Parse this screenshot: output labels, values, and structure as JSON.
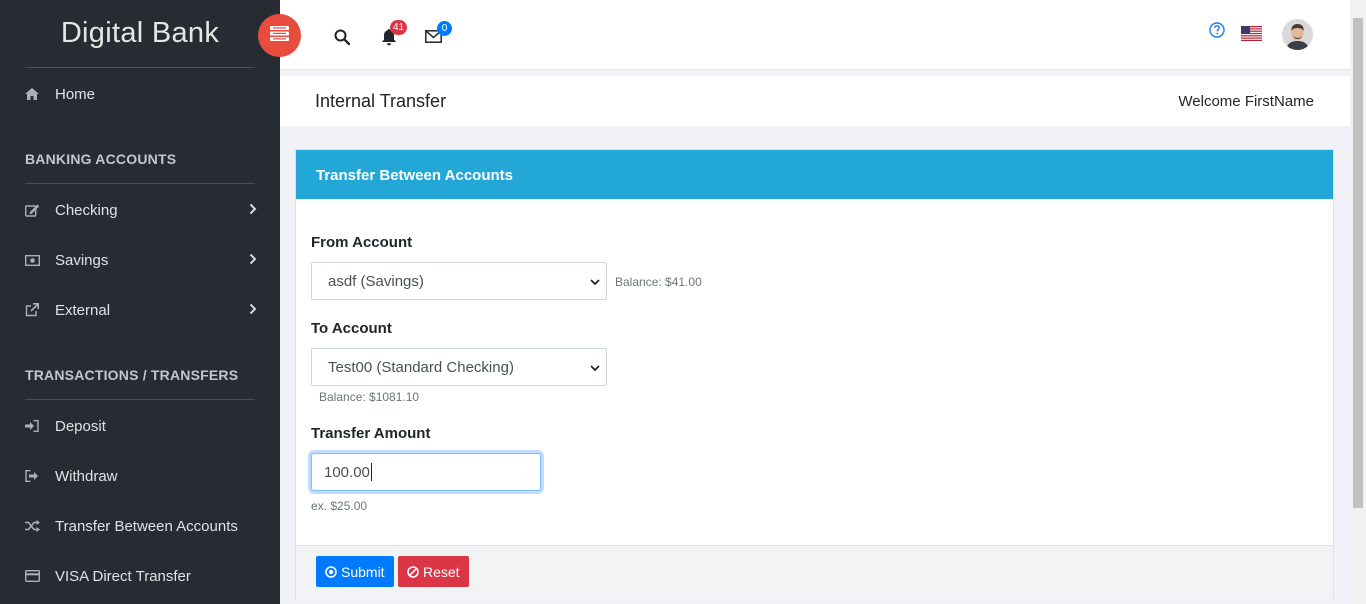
{
  "brand": {
    "light": "Digital",
    "bold": "Bank"
  },
  "header": {
    "notifications_count": "41",
    "messages_count": "0"
  },
  "sidebar": {
    "home": "Home",
    "section_accounts": "BANKING ACCOUNTS",
    "checking": "Checking",
    "savings": "Savings",
    "external": "External",
    "section_transactions": "TRANSACTIONS / TRANSFERS",
    "deposit": "Deposit",
    "withdraw": "Withdraw",
    "transfer": "Transfer Between Accounts",
    "visa": "VISA Direct Transfer"
  },
  "page": {
    "title": "Internal Transfer",
    "welcome": "Welcome FirstName"
  },
  "form": {
    "card_title": "Transfer Between Accounts",
    "from_label": "From Account",
    "from_value": "asdf (Savings)",
    "from_balance": "Balance: $41.00",
    "to_label": "To Account",
    "to_value": "Test00 (Standard Checking)",
    "to_balance": "Balance: $1081.10",
    "amount_label": "Transfer Amount",
    "amount_value": "100.00",
    "amount_hint": "ex. $25.00",
    "submit": "Submit",
    "reset": "Reset"
  },
  "colors": {
    "sidebar_bg": "#272c33",
    "accent_red": "#e84c3d",
    "card_header": "#22a7d6",
    "submit": "#007bff",
    "reset": "#dc3545"
  }
}
